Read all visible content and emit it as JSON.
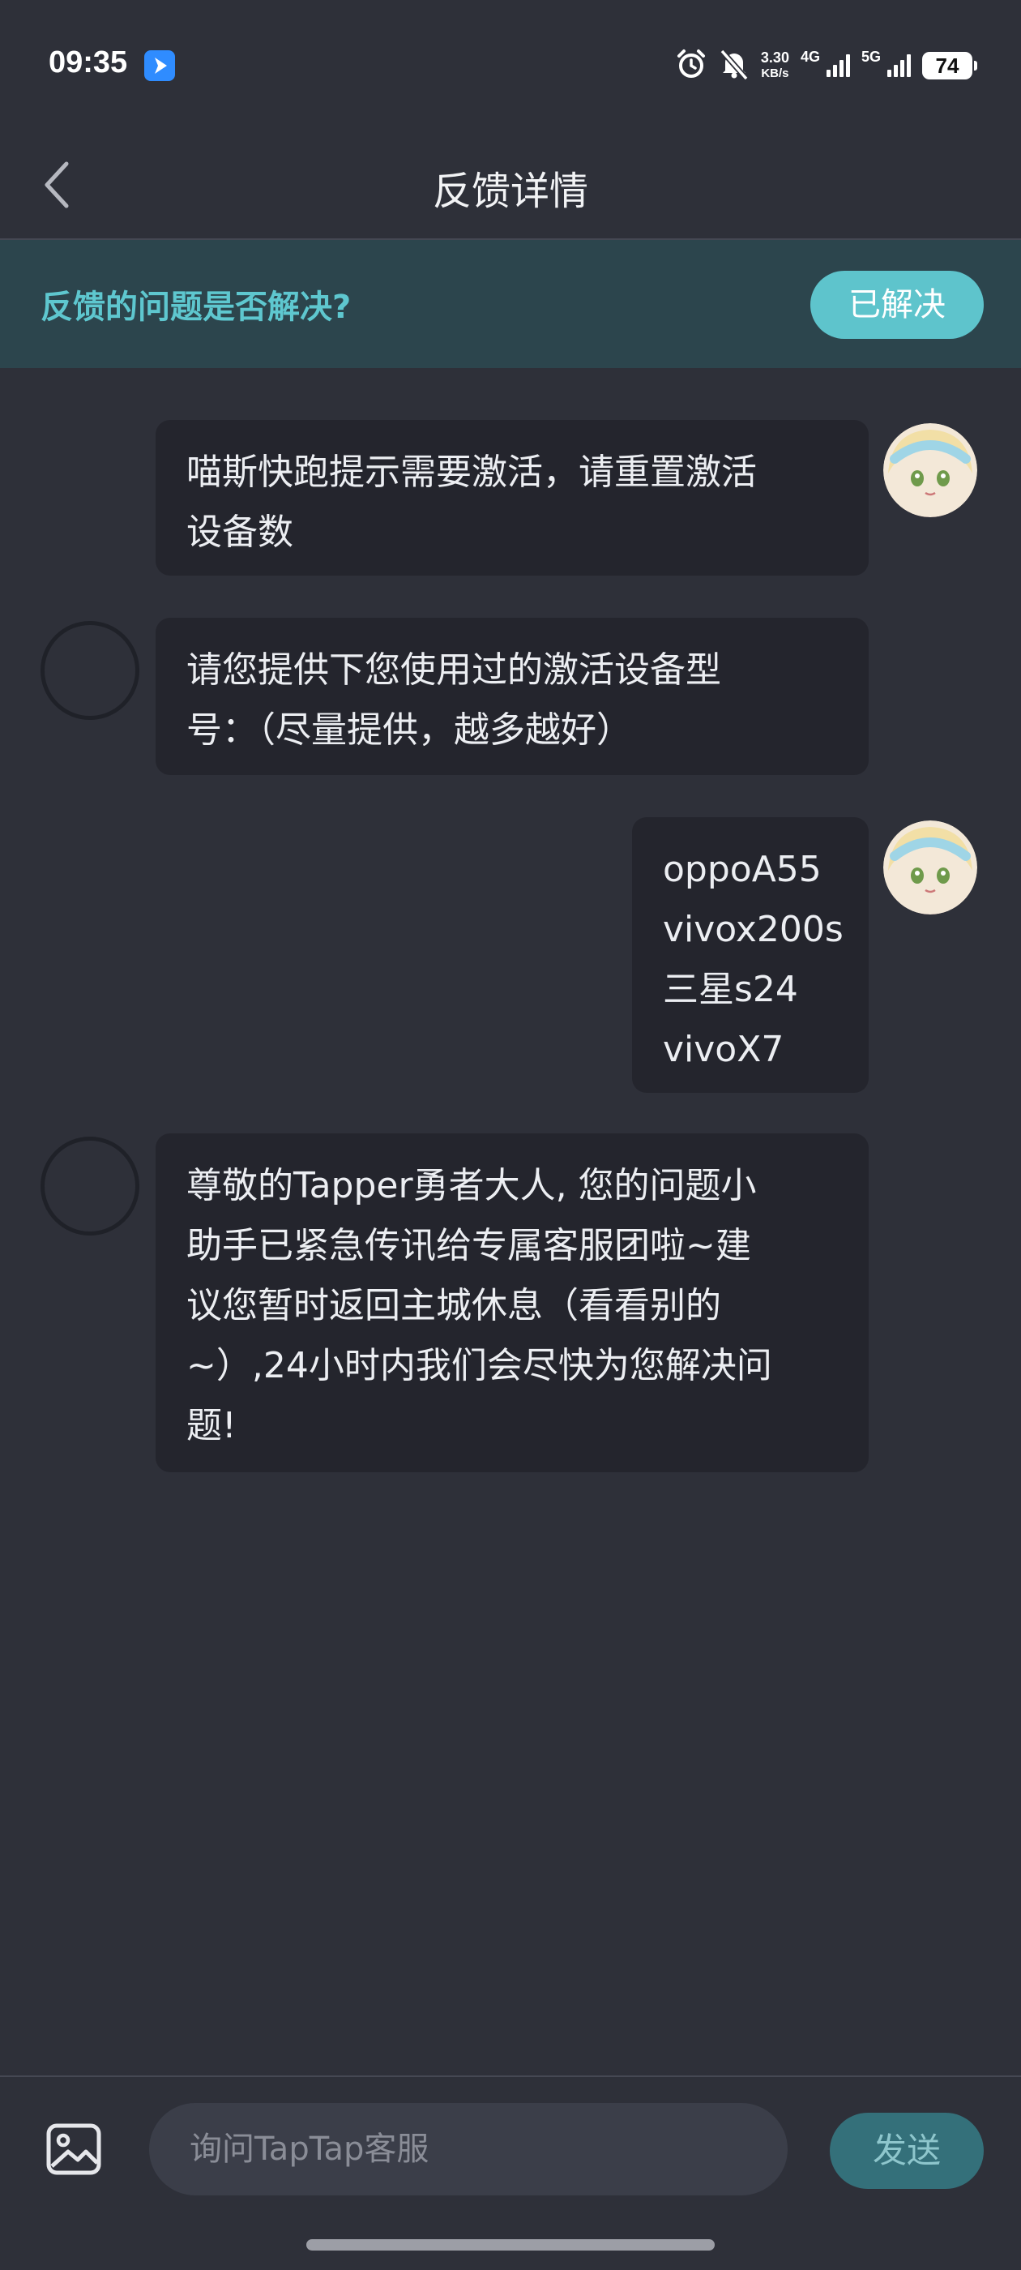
{
  "status_bar": {
    "time": "09:35",
    "net_speed_value": "3.30",
    "net_speed_unit": "KB/s",
    "sim1_network": "4G",
    "sim2_network": "5G",
    "battery": "74"
  },
  "header": {
    "title": "反馈详情"
  },
  "feedback_banner": {
    "question": "反馈的问题是否解决?",
    "resolved_label": "已解决",
    "accent_color": "#5ec4cc"
  },
  "messages": [
    {
      "sender": "user",
      "lines": [
        "喵斯快跑提示需要激活，请重置激活",
        "设备数"
      ]
    },
    {
      "sender": "support",
      "lines": [
        "请您提供下您使用过的激活设备型",
        "号：（尽量提供，越多越好）"
      ]
    },
    {
      "sender": "user",
      "lines": [
        "oppoA55",
        "vivox200s",
        "三星s24",
        "vivoX7"
      ]
    },
    {
      "sender": "support",
      "lines": [
        "尊敬的Tapper勇者大人, 您的问题小",
        "助手已紧急传讯给专属客服团啦~建",
        "议您暂时返回主城休息（看看别的",
        "~）,24小时内我们会尽快为您解决问",
        "题!"
      ]
    }
  ],
  "composer": {
    "placeholder": "询问TapTap客服",
    "send_label": "发送"
  }
}
